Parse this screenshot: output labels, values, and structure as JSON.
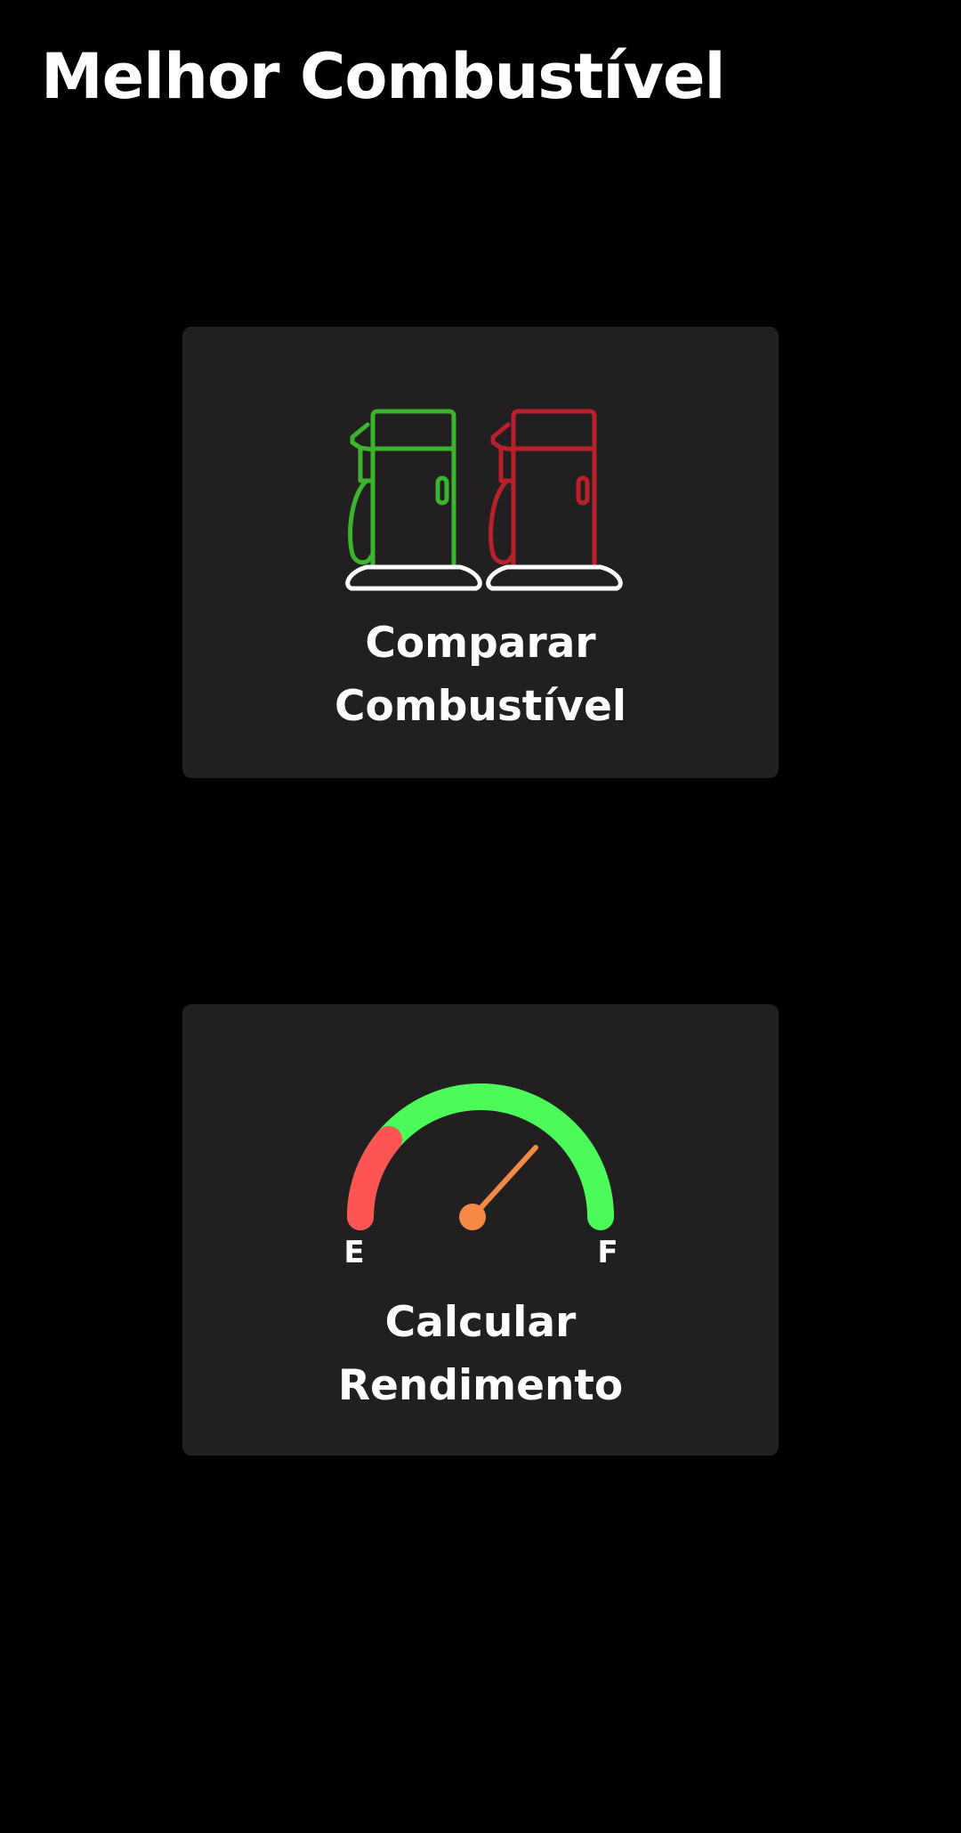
{
  "header": {
    "title": "Melhor Combustível"
  },
  "cards": {
    "compare": {
      "label_line1": "Comparar",
      "label_line2": "Combustível",
      "icon": "fuel-pumps-icon",
      "colors": {
        "pump_left": "#3cb52e",
        "pump_right": "#b8212b",
        "base": "#ffffff"
      }
    },
    "yield": {
      "label_line1": "Calcular",
      "label_line2": "Rendimento",
      "icon": "fuel-gauge-icon",
      "gauge": {
        "empty_label": "E",
        "full_label": "F",
        "colors": {
          "arc": "#4cfa5a",
          "low": "#ff5454",
          "needle": "#f58a47"
        }
      }
    }
  },
  "theme": {
    "background": "#000000",
    "card_background": "#211f20",
    "text": "#ffffff"
  }
}
